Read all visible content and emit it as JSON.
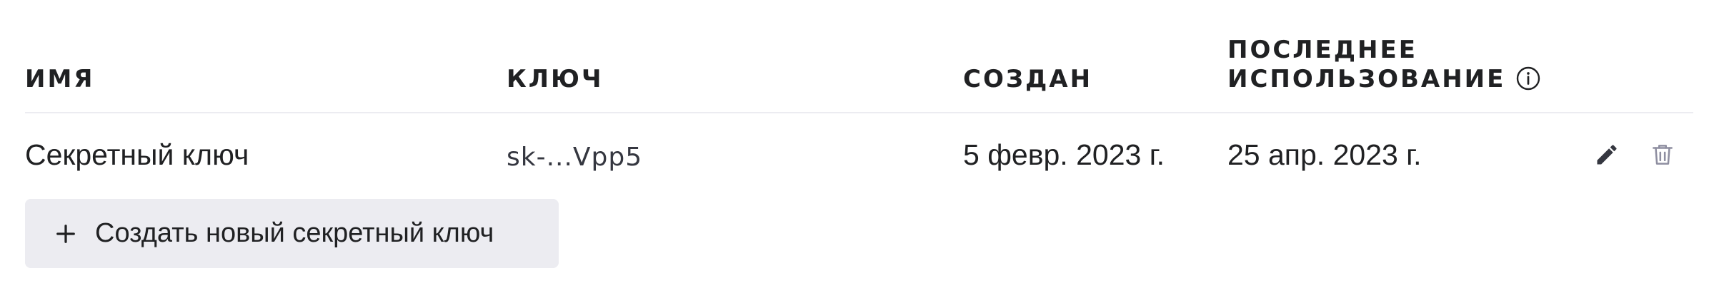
{
  "table": {
    "headers": {
      "name": "ИМЯ",
      "key": "КЛЮЧ",
      "created": "СОЗДАН",
      "last_used_line1": "ПОСЛЕДНЕЕ",
      "last_used_line2": "ИСПОЛЬЗОВАНИЕ"
    },
    "rows": [
      {
        "name": "Секретный ключ",
        "key": "sk-...Vpp5",
        "created": "5 февр. 2023 г.",
        "last_used": "25 апр. 2023 г."
      }
    ]
  },
  "actions": {
    "create_label": "Создать новый секретный ключ"
  },
  "icons": {
    "info": "info-icon",
    "edit": "pencil-icon",
    "delete": "trash-icon",
    "create": "plus-icon"
  },
  "colors": {
    "text": "#202123",
    "divider": "#ececf1",
    "button_bg": "#ececf1",
    "edit_icon": "#353740",
    "delete_icon": "#8e8ea0"
  }
}
